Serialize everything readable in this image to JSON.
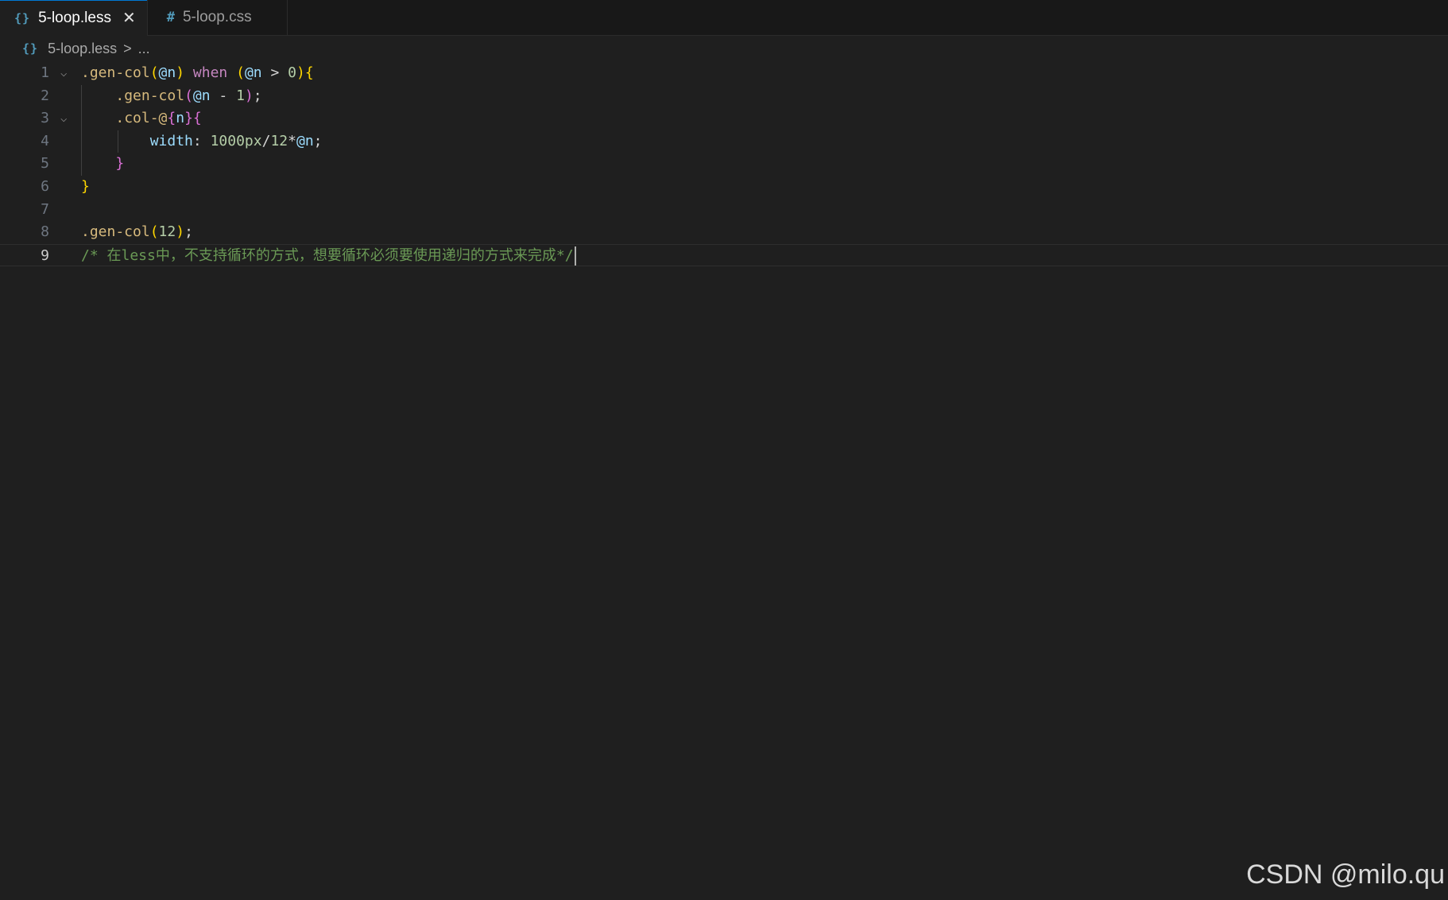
{
  "tabs": [
    {
      "icon": "{}",
      "label": "5-loop.less",
      "active": true,
      "close": "✕"
    },
    {
      "icon": "#",
      "label": "5-loop.css",
      "active": false
    }
  ],
  "breadcrumb": {
    "icon": "{}",
    "file": "5-loop.less",
    "separator": ">",
    "more": "..."
  },
  "editor": {
    "lines": [
      {
        "num": "1",
        "fold": true,
        "tokens": [
          {
            "t": ".gen-col",
            "c": "t-sel"
          },
          {
            "t": "(",
            "c": "t-b1"
          },
          {
            "t": "@n",
            "c": "t-var"
          },
          {
            "t": ")",
            "c": "t-b1"
          },
          {
            "t": " when ",
            "c": "t-kw"
          },
          {
            "t": "(",
            "c": "t-b1"
          },
          {
            "t": "@n",
            "c": "t-var"
          },
          {
            "t": " > ",
            "c": "t-punc"
          },
          {
            "t": "0",
            "c": "t-num"
          },
          {
            "t": ")",
            "c": "t-b1"
          },
          {
            "t": "{",
            "c": "t-b1"
          }
        ]
      },
      {
        "num": "2",
        "fold": false,
        "tokens": [
          {
            "t": "    ",
            "c": "t-punc"
          },
          {
            "t": ".gen-col",
            "c": "t-sel"
          },
          {
            "t": "(",
            "c": "t-b2"
          },
          {
            "t": "@n",
            "c": "t-var"
          },
          {
            "t": " - ",
            "c": "t-punc"
          },
          {
            "t": "1",
            "c": "t-num"
          },
          {
            "t": ")",
            "c": "t-b2"
          },
          {
            "t": ";",
            "c": "t-punc"
          }
        ]
      },
      {
        "num": "3",
        "fold": true,
        "tokens": [
          {
            "t": "    ",
            "c": "t-punc"
          },
          {
            "t": ".col-@",
            "c": "t-sel"
          },
          {
            "t": "{",
            "c": "t-b2"
          },
          {
            "t": "n",
            "c": "t-var"
          },
          {
            "t": "}",
            "c": "t-b2"
          },
          {
            "t": "{",
            "c": "t-b2"
          }
        ]
      },
      {
        "num": "4",
        "fold": false,
        "tokens": [
          {
            "t": "        ",
            "c": "t-punc"
          },
          {
            "t": "width",
            "c": "t-prop"
          },
          {
            "t": ": ",
            "c": "t-punc"
          },
          {
            "t": "1000px",
            "c": "t-num"
          },
          {
            "t": "/",
            "c": "t-punc"
          },
          {
            "t": "12",
            "c": "t-num"
          },
          {
            "t": "*",
            "c": "t-punc"
          },
          {
            "t": "@n",
            "c": "t-var"
          },
          {
            "t": ";",
            "c": "t-punc"
          }
        ]
      },
      {
        "num": "5",
        "fold": false,
        "tokens": [
          {
            "t": "    ",
            "c": "t-punc"
          },
          {
            "t": "}",
            "c": "t-b2"
          }
        ]
      },
      {
        "num": "6",
        "fold": false,
        "tokens": [
          {
            "t": "}",
            "c": "t-b1"
          }
        ]
      },
      {
        "num": "7",
        "fold": false,
        "tokens": []
      },
      {
        "num": "8",
        "fold": false,
        "tokens": [
          {
            "t": ".gen-col",
            "c": "t-sel"
          },
          {
            "t": "(",
            "c": "t-b1"
          },
          {
            "t": "12",
            "c": "t-num"
          },
          {
            "t": ")",
            "c": "t-b1"
          },
          {
            "t": ";",
            "c": "t-punc"
          }
        ]
      },
      {
        "num": "9",
        "fold": false,
        "current": true,
        "cursor": true,
        "tokens": [
          {
            "t": "/* 在less中，不支持循环的方式，想要循环必须要使用递归的方式来完成*/",
            "c": "t-com"
          }
        ]
      }
    ]
  },
  "watermark": "CSDN @milo.qu"
}
